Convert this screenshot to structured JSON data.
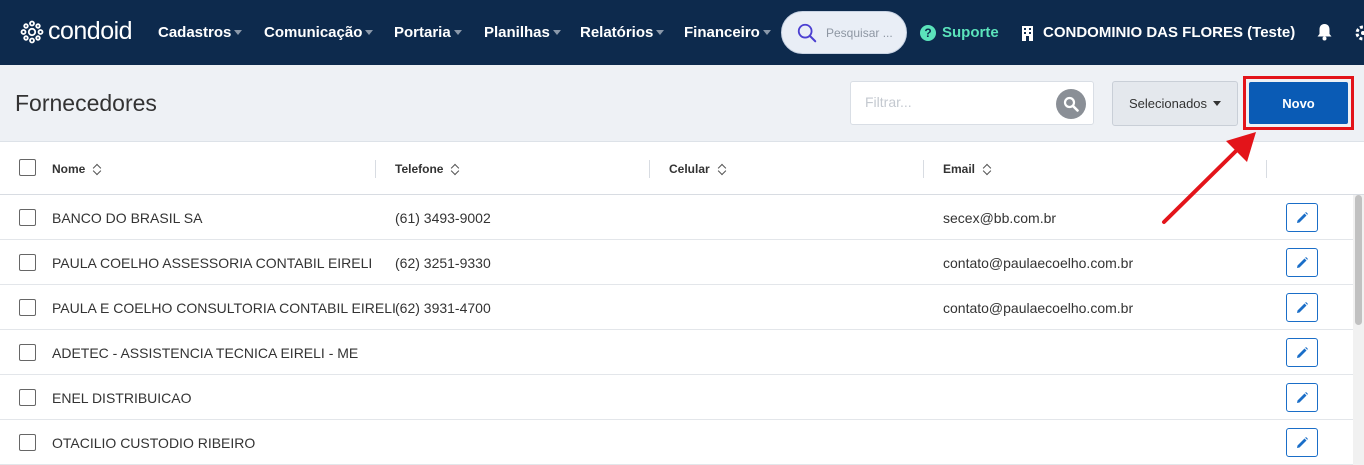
{
  "brand": {
    "name": "condoid"
  },
  "nav": {
    "items": [
      {
        "label": "Cadastros"
      },
      {
        "label": "Comunicação"
      },
      {
        "label": "Portaria"
      },
      {
        "label": "Planilhas"
      },
      {
        "label": "Relatórios"
      },
      {
        "label": "Financeiro"
      }
    ],
    "search_placeholder": "Pesquisar ...",
    "support_label": "Suporte",
    "condo_label": "CONDOMINIO DAS FLORES (Teste)",
    "icons": [
      "search-icon",
      "help-icon",
      "building-icon",
      "bell-icon",
      "gear-icon"
    ]
  },
  "page": {
    "title": "Fornecedores",
    "filter_placeholder": "Filtrar...",
    "selected_label": "Selecionados",
    "new_label": "Novo"
  },
  "table": {
    "columns": [
      "Nome",
      "Telefone",
      "Celular",
      "Email"
    ],
    "rows": [
      {
        "nome": "BANCO DO BRASIL SA",
        "telefone": "(61) 3493-9002",
        "celular": "",
        "email": "secex@bb.com.br"
      },
      {
        "nome": "PAULA COELHO ASSESSORIA CONTABIL EIRELI",
        "telefone": "(62) 3251-9330",
        "celular": "",
        "email": "contato@paulaecoelho.com.br"
      },
      {
        "nome": "PAULA E COELHO CONSULTORIA CONTABIL EIRELI",
        "telefone": "(62) 3931-4700",
        "celular": "",
        "email": "contato@paulaecoelho.com.br"
      },
      {
        "nome": "ADETEC - ASSISTENCIA TECNICA EIRELI - ME",
        "telefone": "",
        "celular": "",
        "email": ""
      },
      {
        "nome": "ENEL DISTRIBUICAO",
        "telefone": "",
        "celular": "",
        "email": ""
      },
      {
        "nome": "OTACILIO CUSTODIO RIBEIRO",
        "telefone": "",
        "celular": "",
        "email": ""
      }
    ]
  },
  "colors": {
    "nav_bg": "#0d2a4d",
    "support": "#5be3bb",
    "primary_button": "#0a5bb5",
    "highlight": "#e3141a"
  }
}
